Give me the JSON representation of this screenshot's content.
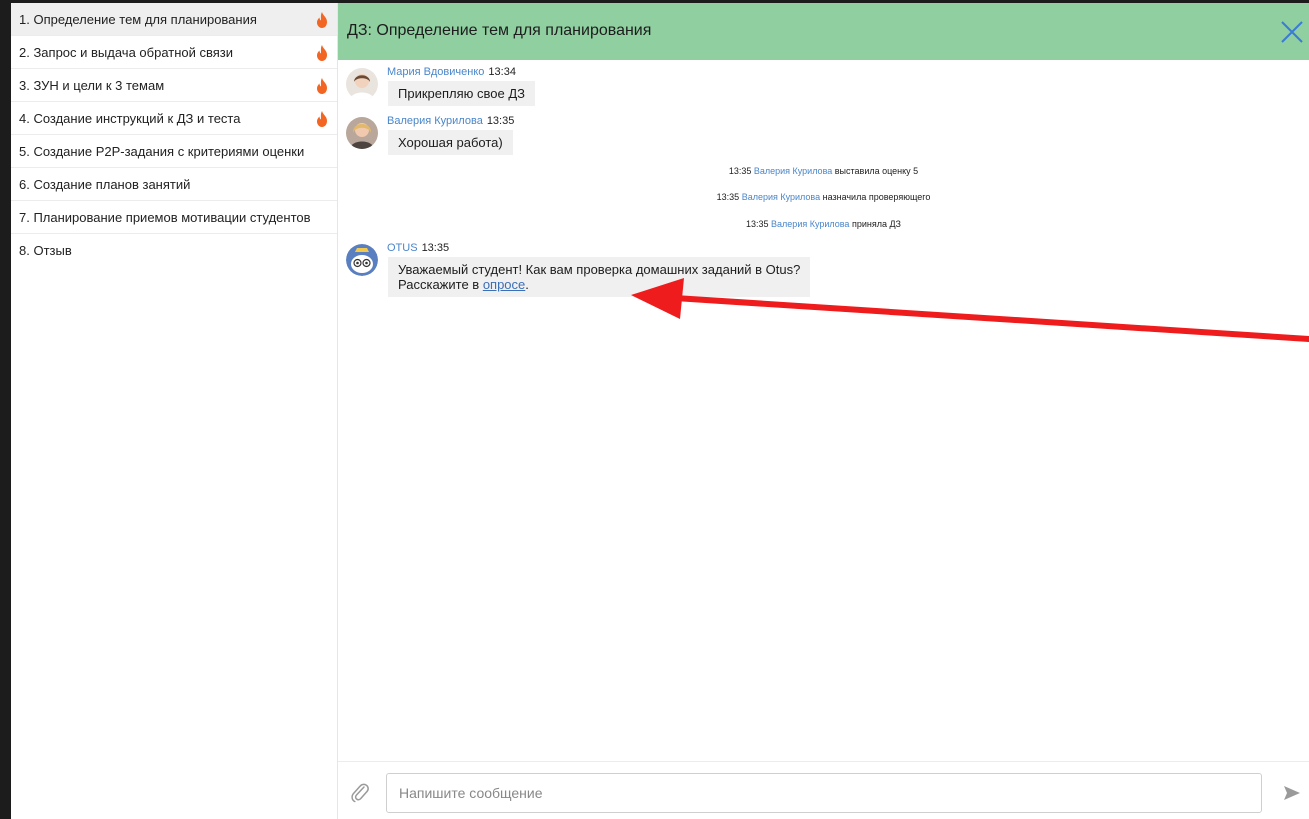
{
  "sidebar": {
    "topics": [
      {
        "label": "1. Определение тем для планирования",
        "hot": true
      },
      {
        "label": "2. Запрос и выдача обратной связи",
        "hot": true
      },
      {
        "label": "3. ЗУН и цели к 3 темам",
        "hot": true
      },
      {
        "label": "4. Создание инструкций к ДЗ и теста",
        "hot": true
      },
      {
        "label": "5. Создание P2P-задания с критериями оценки",
        "hot": false
      },
      {
        "label": "6. Создание планов занятий",
        "hot": false
      },
      {
        "label": "7. Планирование приемов мотивации студентов",
        "hot": false
      },
      {
        "label": "8. Отзыв",
        "hot": false
      }
    ]
  },
  "chat": {
    "title": "ДЗ: Определение тем для планирования",
    "messages": [
      {
        "author": "Мария Вдовиченко",
        "time": "13:34",
        "text": "Прикрепляю свое ДЗ"
      },
      {
        "author": "Валерия Курилова",
        "time": "13:35",
        "text": "Хорошая работа)"
      }
    ],
    "system_events": [
      {
        "time": "13:35",
        "user": "Валерия Курилова",
        "action": "выставила оценку 5"
      },
      {
        "time": "13:35",
        "user": "Валерия Курилова",
        "action": "назначила проверяющего"
      },
      {
        "time": "13:35",
        "user": "Валерия Курилова",
        "action": "приняла ДЗ"
      }
    ],
    "bot_message": {
      "author": "OTUS",
      "time": "13:35",
      "line1": "Уважаемый студент! Как вам проверка домашних заданий в Otus?",
      "line2_prefix": "Расскажите в ",
      "link_text": "опросе",
      "line2_suffix": "."
    }
  },
  "composer": {
    "placeholder": "Напишите сообщение"
  },
  "colors": {
    "header_bg": "#8fcfa0",
    "link": "#4a86c9",
    "flame": "#f26522",
    "annotation_arrow": "#ee1c1c",
    "close_icon": "#3a7bd5"
  }
}
